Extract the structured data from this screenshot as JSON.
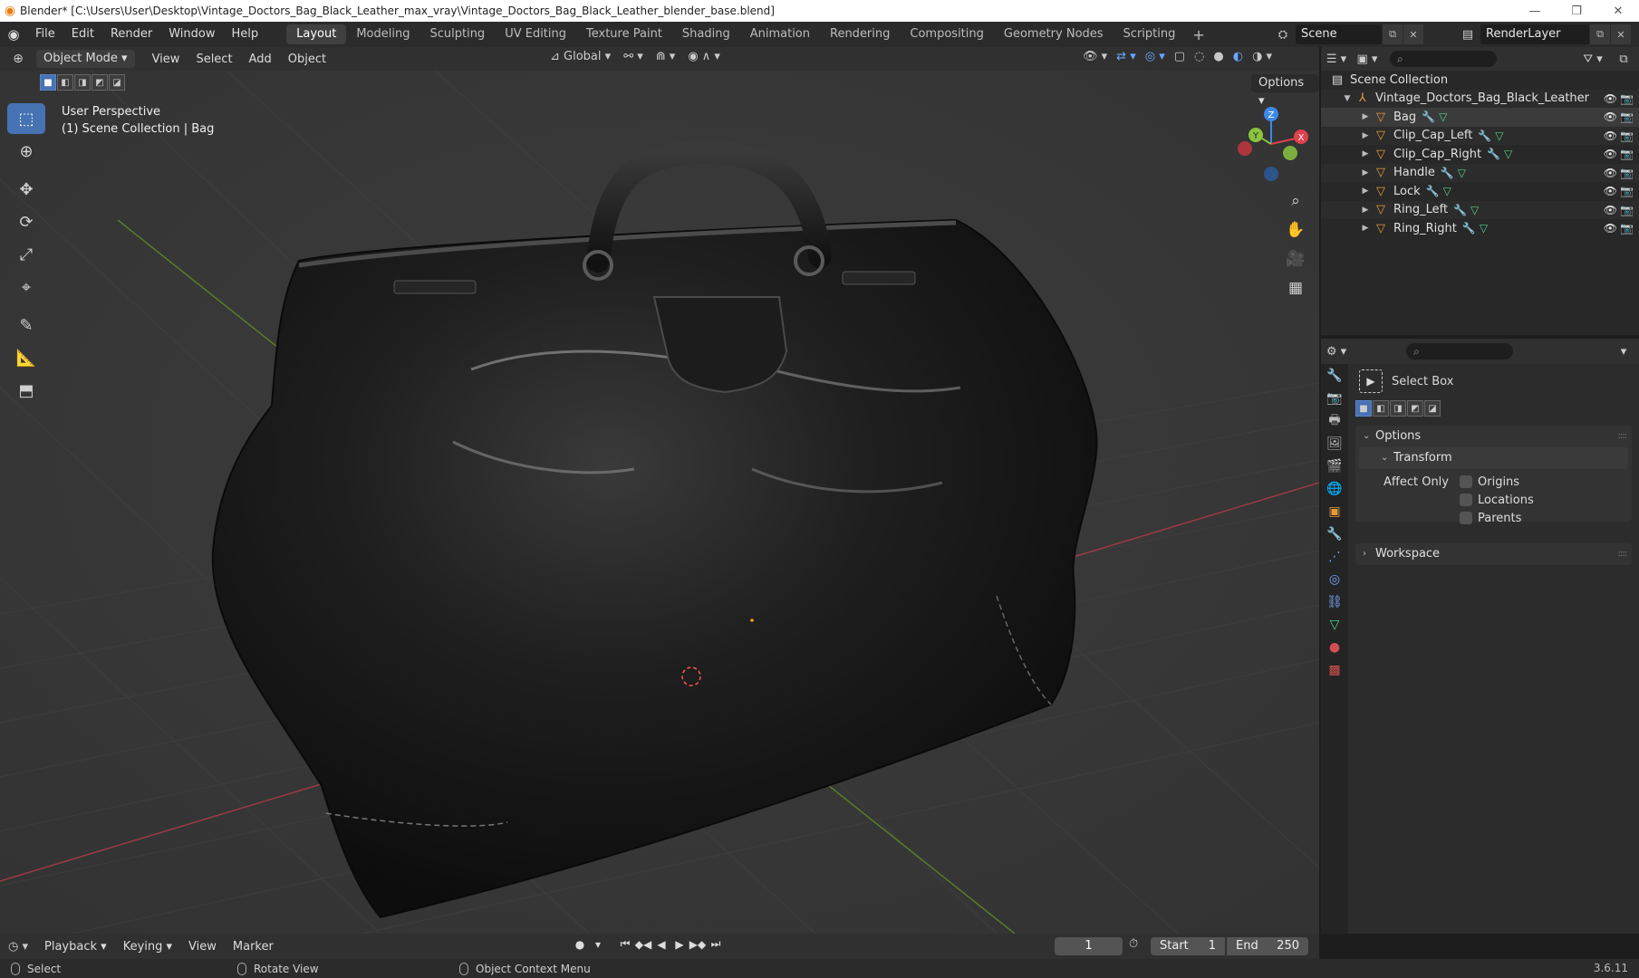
{
  "window": {
    "title": "Blender* [C:\\Users\\User\\Desktop\\Vintage_Doctors_Bag_Black_Leather_max_vray\\Vintage_Doctors_Bag_Black_Leather_blender_base.blend]",
    "minimize": "—",
    "restore": "❐",
    "close": "✕"
  },
  "menubar": {
    "items": [
      "File",
      "Edit",
      "Render",
      "Window",
      "Help"
    ],
    "workspaces": [
      "Layout",
      "Modeling",
      "Sculpting",
      "UV Editing",
      "Texture Paint",
      "Shading",
      "Animation",
      "Rendering",
      "Compositing",
      "Geometry Nodes",
      "Scripting"
    ],
    "active_workspace": "Layout",
    "add_workspace": "+",
    "scene": "Scene",
    "render_layer": "RenderLayer"
  },
  "viewport_header": {
    "mode": "Object Mode",
    "menus": [
      "View",
      "Select",
      "Add",
      "Object"
    ],
    "orientation": "Global",
    "options": "Options"
  },
  "viewport": {
    "perspective": "User Perspective",
    "collection_info": "(1) Scene Collection | Bag",
    "gizmo": {
      "x": "X",
      "y": "Y",
      "z": "Z"
    }
  },
  "outliner": {
    "root": "Scene Collection",
    "collection": "Vintage_Doctors_Bag_Black_Leather",
    "objects": [
      "Bag",
      "Clip_Cap_Left",
      "Clip_Cap_Right",
      "Handle",
      "Lock",
      "Ring_Left",
      "Ring_Right"
    ]
  },
  "properties": {
    "tool_name": "Select Box",
    "panel_options": "Options",
    "subpanel_transform": "Transform",
    "affect_only_label": "Affect Only",
    "checkboxes": [
      "Origins",
      "Locations",
      "Parents"
    ],
    "panel_workspace": "Workspace"
  },
  "timeline": {
    "menus": [
      "Playback",
      "Keying",
      "View",
      "Marker"
    ],
    "current_frame": "1",
    "start_label": "Start",
    "start_value": "1",
    "end_label": "End",
    "end_value": "250"
  },
  "statusbar": {
    "select": "Select",
    "rotate": "Rotate View",
    "context": "Object Context Menu",
    "version": "3.6.11"
  },
  "colors": {
    "accent": "#4772b3",
    "object_icon": "#e89a3c",
    "modifier_icon": "#79a7ff",
    "mesh_icon": "#4fd18a",
    "x_axis": "#e0414d",
    "y_axis": "#8ac43f",
    "z_axis": "#3d88e6"
  }
}
